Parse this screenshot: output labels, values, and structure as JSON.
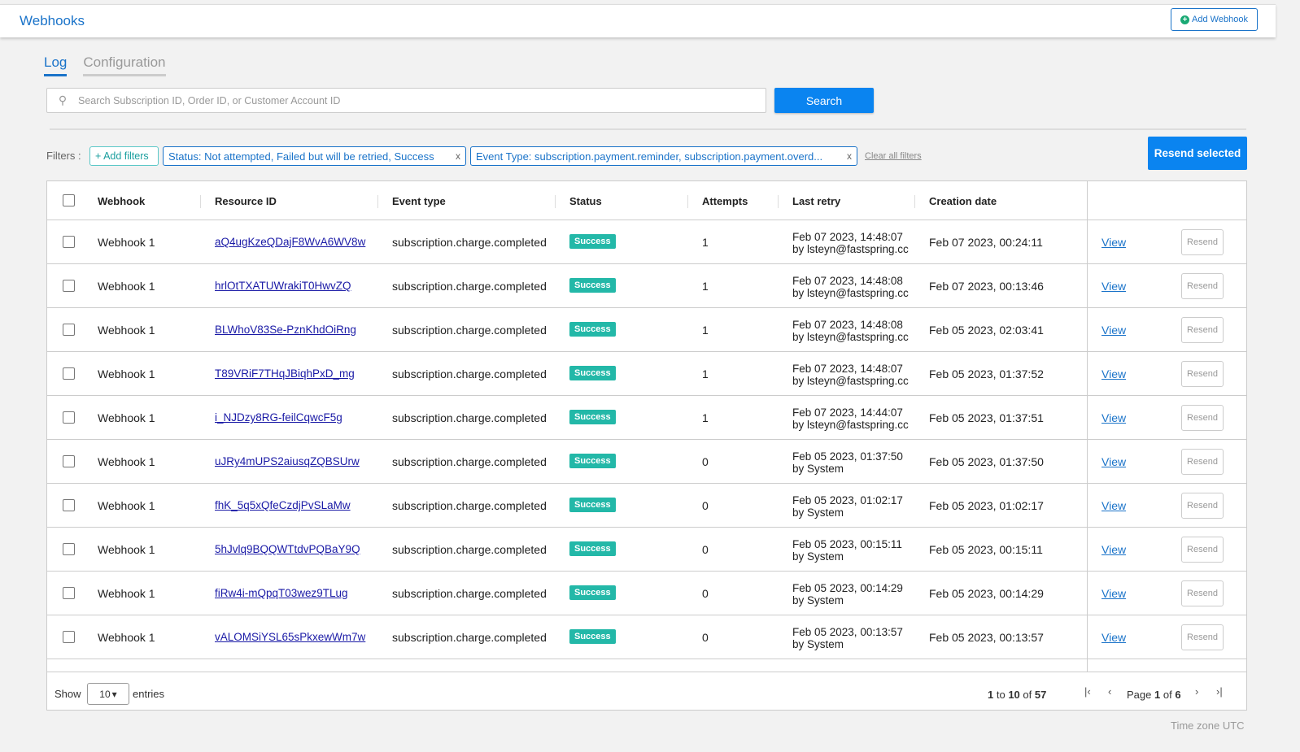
{
  "header": {
    "title": "Webhooks",
    "add_button": "Add Webhook"
  },
  "tabs": [
    {
      "label": "Log",
      "active": true
    },
    {
      "label": "Configuration",
      "active": false
    }
  ],
  "search": {
    "placeholder": "Search Subscription ID, Order ID, or Customer Account ID",
    "button_label": "Search"
  },
  "filters": {
    "label": "Filters :",
    "add_label": "+ Add filters",
    "chips": [
      {
        "text": "Status: Not attempted, Failed but will be retried, Success",
        "close": "x"
      },
      {
        "text": "Event Type: subscription.payment.reminder, subscription.payment.overd...",
        "close": "x"
      }
    ],
    "clear_all": "Clear all filters",
    "resend_selected": "Resend selected"
  },
  "table": {
    "columns": [
      "Webhook",
      "Resource ID",
      "Event type",
      "Status",
      "Attempts",
      "Last retry",
      "Creation date"
    ],
    "rows": [
      {
        "webhook": "Webhook 1",
        "resource_id": "aQ4ugKzeQDajF8WvA6WV8w",
        "event": "subscription.charge.completed",
        "status": "Success",
        "attempts": "1",
        "retry_date": "Feb 07 2023, 14:48:07",
        "retry_by": "by lsteyn@fastspring.cc",
        "created": "Feb 07 2023, 00:24:11",
        "view": "View",
        "resend": "Resend"
      },
      {
        "webhook": "Webhook 1",
        "resource_id": "hrlOtTXATUWrakiT0HwvZQ",
        "event": "subscription.charge.completed",
        "status": "Success",
        "attempts": "1",
        "retry_date": "Feb 07 2023, 14:48:08",
        "retry_by": "by lsteyn@fastspring.cc",
        "created": "Feb 07 2023, 00:13:46",
        "view": "View",
        "resend": "Resend"
      },
      {
        "webhook": "Webhook 1",
        "resource_id": "BLWhoV83Se-PznKhdOiRng",
        "event": "subscription.charge.completed",
        "status": "Success",
        "attempts": "1",
        "retry_date": "Feb 07 2023, 14:48:08",
        "retry_by": "by lsteyn@fastspring.cc",
        "created": "Feb 05 2023, 02:03:41",
        "view": "View",
        "resend": "Resend"
      },
      {
        "webhook": "Webhook 1",
        "resource_id": "T89VRiF7THqJBiqhPxD_mg",
        "event": "subscription.charge.completed",
        "status": "Success",
        "attempts": "1",
        "retry_date": "Feb 07 2023, 14:48:07",
        "retry_by": "by lsteyn@fastspring.cc",
        "created": "Feb 05 2023, 01:37:52",
        "view": "View",
        "resend": "Resend"
      },
      {
        "webhook": "Webhook 1",
        "resource_id": "i_NJDzy8RG-feilCqwcF5g",
        "event": "subscription.charge.completed",
        "status": "Success",
        "attempts": "1",
        "retry_date": "Feb 07 2023, 14:44:07",
        "retry_by": "by lsteyn@fastspring.cc",
        "created": "Feb 05 2023, 01:37:51",
        "view": "View",
        "resend": "Resend"
      },
      {
        "webhook": "Webhook 1",
        "resource_id": "uJRy4mUPS2aiusqZQBSUrw",
        "event": "subscription.charge.completed",
        "status": "Success",
        "attempts": "0",
        "retry_date": "Feb 05 2023, 01:37:50",
        "retry_by": "by System",
        "created": "Feb 05 2023, 01:37:50",
        "view": "View",
        "resend": "Resend"
      },
      {
        "webhook": "Webhook 1",
        "resource_id": "fhK_5q5xQfeCzdjPvSLaMw",
        "event": "subscription.charge.completed",
        "status": "Success",
        "attempts": "0",
        "retry_date": "Feb 05 2023, 01:02:17",
        "retry_by": "by System",
        "created": "Feb 05 2023, 01:02:17",
        "view": "View",
        "resend": "Resend"
      },
      {
        "webhook": "Webhook 1",
        "resource_id": "5hJvlq9BQQWTtdvPQBaY9Q",
        "event": "subscription.charge.completed",
        "status": "Success",
        "attempts": "0",
        "retry_date": "Feb 05 2023, 00:15:11",
        "retry_by": "by System",
        "created": "Feb 05 2023, 00:15:11",
        "view": "View",
        "resend": "Resend"
      },
      {
        "webhook": "Webhook 1",
        "resource_id": "fiRw4i-mQpqT03wez9TLug",
        "event": "subscription.charge.completed",
        "status": "Success",
        "attempts": "0",
        "retry_date": "Feb 05 2023, 00:14:29",
        "retry_by": "by System",
        "created": "Feb 05 2023, 00:14:29",
        "view": "View",
        "resend": "Resend"
      },
      {
        "webhook": "Webhook 1",
        "resource_id": "vALOMSiYSL65sPkxewWm7w",
        "event": "subscription.charge.completed",
        "status": "Success",
        "attempts": "0",
        "retry_date": "Feb 05 2023, 00:13:57",
        "retry_by": "by System",
        "created": "Feb 05 2023, 00:13:57",
        "view": "View",
        "resend": "Resend"
      }
    ]
  },
  "footer": {
    "show_label": "Show",
    "entries_value": "10",
    "entries_label": "entries",
    "range_start": "1",
    "range_to": "to",
    "range_end": "10",
    "range_of": "of",
    "range_total": "57",
    "page_word": "Page",
    "page_current": "1",
    "page_of": "of",
    "page_total": "6"
  },
  "timezone": "Time zone UTC",
  "colors": {
    "primary": "#0a84f0",
    "link": "#1a73c9",
    "success_badge": "#23b8a8"
  },
  "icons": {
    "search": "magnifier-icon",
    "add": "plus-circle-icon",
    "first_page": "first-page-icon",
    "prev_page": "prev-page-icon",
    "next_page": "next-page-icon",
    "last_page": "last-page-icon"
  }
}
